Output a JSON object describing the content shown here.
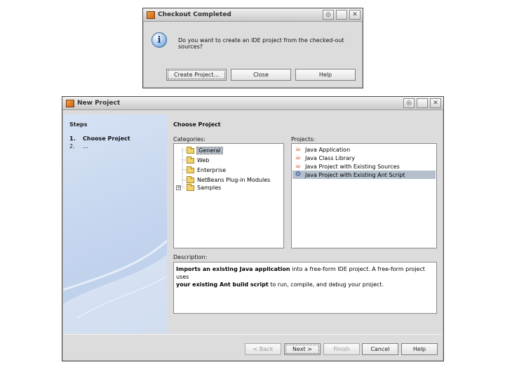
{
  "checkout_dialog": {
    "title": "Checkout Completed",
    "message": "Do you want to create an IDE project from the checked-out sources?",
    "buttons": {
      "create": "Create Project...",
      "close": "Close",
      "help": "Help"
    }
  },
  "new_project": {
    "title": "New Project",
    "steps_heading": "Steps",
    "steps": [
      {
        "num": "1.",
        "label": "Choose Project"
      },
      {
        "num": "2.",
        "label": "..."
      }
    ],
    "main_heading": "Choose Project",
    "categories_label": "Categories:",
    "projects_label": "Projects:",
    "categories": [
      "General",
      "Web",
      "Enterprise",
      "NetBeans Plug-in Modules",
      "Samples"
    ],
    "selected_category": "General",
    "projects": [
      "Java Application",
      "Java Class Library",
      "Java Project with Existing Sources",
      "Java Project with Existing Ant Script"
    ],
    "selected_project": "Java Project with Existing Ant Script",
    "description_label": "Description:",
    "description_bold_1": "Imports an existing Java application",
    "description_text_1": " into a free-form IDE project. A free-form project uses",
    "description_bold_2": "your existing Ant build script",
    "description_text_2": " to run, compile, and debug your project.",
    "buttons": {
      "back": "< Back",
      "next": "Next >",
      "finish": "Finish",
      "cancel": "Cancel",
      "help": "Help"
    }
  },
  "colors": {
    "steps_panel": "#c9d8ef",
    "selection": "#b6c0cc",
    "window_bg": "#dcdcdc"
  }
}
